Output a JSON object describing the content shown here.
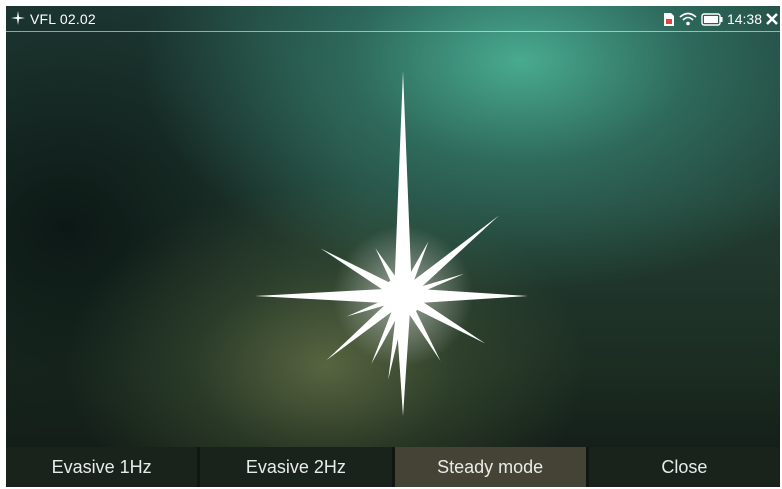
{
  "status_bar": {
    "app_title": "VFL 02.02",
    "time": "14:38",
    "icons": [
      "sd-card-icon",
      "wifi-icon",
      "battery-icon",
      "close-icon"
    ]
  },
  "main": {
    "visual": "laser-flare"
  },
  "bottom_buttons": [
    {
      "label": "Evasive 1Hz",
      "active": false
    },
    {
      "label": "Evasive 2Hz",
      "active": false
    },
    {
      "label": "Steady mode",
      "active": true
    },
    {
      "label": "Close",
      "active": false
    }
  ],
  "colors": {
    "active_button": "#454335",
    "inactive_button": "#1a221c",
    "flare": "#ffffff"
  }
}
